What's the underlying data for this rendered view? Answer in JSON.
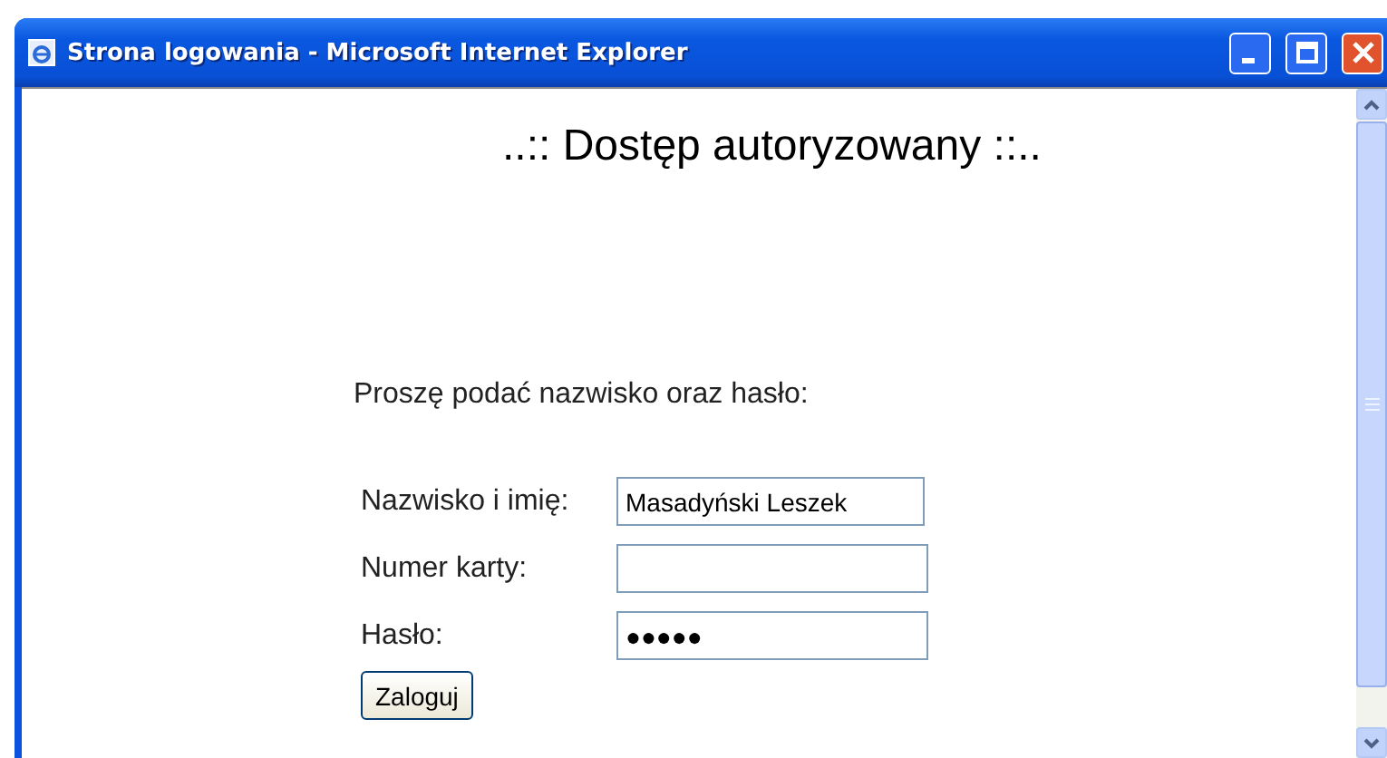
{
  "window": {
    "title": "Strona logowania - Microsoft Internet Explorer"
  },
  "heading": "..:: Dostęp autoryzowany ::..",
  "instruction": "Proszę podać nazwisko oraz hasło:",
  "fields": [
    {
      "label": "Nazwisko i imię:",
      "value": "Masadyński Leszek"
    },
    {
      "label": "Numer karty:"
    },
    {
      "label": "Hasło:",
      "value": "●●●●●"
    }
  ],
  "button": "Zaloguj"
}
